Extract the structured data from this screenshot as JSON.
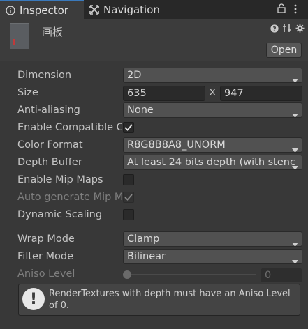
{
  "tabs": [
    {
      "label": "Inspector",
      "icon": "info-icon"
    },
    {
      "label": "Navigation",
      "icon": "navigation-icon"
    }
  ],
  "header": {
    "title": "画板",
    "open_label": "Open"
  },
  "props": {
    "dimension": {
      "label": "Dimension",
      "value": "2D"
    },
    "size": {
      "label": "Size",
      "width": "635",
      "sep": "x",
      "height": "947"
    },
    "anti_aliasing": {
      "label": "Anti-aliasing",
      "value": "None"
    },
    "enable_compatible": {
      "label": "Enable Compatible C",
      "checked": true
    },
    "color_format": {
      "label": "Color Format",
      "value": "R8G8B8A8_UNORM"
    },
    "depth_buffer": {
      "label": "Depth Buffer",
      "value": "At least 24 bits depth (with stenc"
    },
    "enable_mip_maps": {
      "label": "Enable Mip Maps",
      "checked": false
    },
    "auto_generate_mip": {
      "label": "Auto generate Mip M",
      "checked": true,
      "disabled": true
    },
    "dynamic_scaling": {
      "label": "Dynamic Scaling",
      "checked": false
    },
    "wrap_mode": {
      "label": "Wrap Mode",
      "value": "Clamp"
    },
    "filter_mode": {
      "label": "Filter Mode",
      "value": "Bilinear"
    },
    "aniso_level": {
      "label": "Aniso Level",
      "value": "0",
      "disabled": true
    }
  },
  "help": {
    "text": "RenderTextures with depth must have an Aniso Level of 0."
  }
}
